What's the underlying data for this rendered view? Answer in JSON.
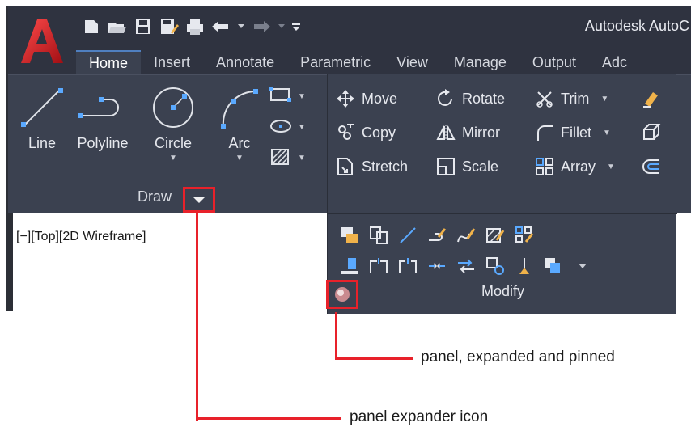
{
  "app": {
    "title": "Autodesk AutoC",
    "logo_letter": "A"
  },
  "tabs": [
    {
      "label": "Home",
      "active": true
    },
    {
      "label": "Insert"
    },
    {
      "label": "Annotate"
    },
    {
      "label": "Parametric"
    },
    {
      "label": "View"
    },
    {
      "label": "Manage"
    },
    {
      "label": "Output"
    },
    {
      "label": "Adc"
    }
  ],
  "draw_panel": {
    "title": "Draw",
    "tools": [
      {
        "label": "Line"
      },
      {
        "label": "Polyline"
      },
      {
        "label": "Circle"
      },
      {
        "label": "Arc"
      }
    ]
  },
  "modify_panel": {
    "title": "Modify",
    "rows": [
      [
        {
          "label": "Move"
        },
        {
          "label": "Rotate"
        },
        {
          "label": "Trim"
        }
      ],
      [
        {
          "label": "Copy"
        },
        {
          "label": "Mirror"
        },
        {
          "label": "Fillet"
        }
      ],
      [
        {
          "label": "Stretch"
        },
        {
          "label": "Scale"
        },
        {
          "label": "Array"
        }
      ]
    ]
  },
  "viewport": {
    "label": "[−][Top][2D Wireframe]"
  },
  "callouts": {
    "pinned": "panel, expanded and pinned",
    "expander": "panel expander icon"
  },
  "colors": {
    "ribbon": "#3b4150",
    "titlebar": "#2f3340",
    "highlight": "#e8212a",
    "text": "#e6e8ee"
  }
}
